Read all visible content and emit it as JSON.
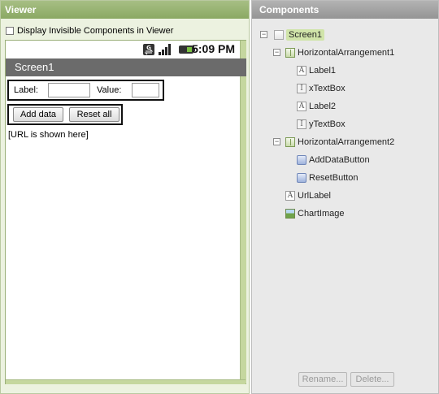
{
  "viewer": {
    "title": "Viewer",
    "invisible_checkbox_label": "Display Invisible Components in Viewer",
    "status_bar": {
      "time": "5:09 PM"
    },
    "screen_title": "Screen1",
    "harr1": {
      "label_text": "Label:",
      "value_text": "Value:"
    },
    "harr2": {
      "add_button": "Add data",
      "reset_button": "Reset all"
    },
    "url_label": "[URL is shown here]"
  },
  "components": {
    "title": "Components",
    "tree": {
      "screen1": "Screen1",
      "harr1": "HorizontalArrangement1",
      "label1": "Label1",
      "xtextbox": "xTextBox",
      "label2": "Label2",
      "ytextbox": "yTextBox",
      "harr2": "HorizontalArrangement2",
      "adddatabutton": "AddDataButton",
      "resetbutton": "ResetButton",
      "urllabel": "UrlLabel",
      "chartimage": "ChartImage"
    },
    "rename_button": "Rename...",
    "delete_button": "Delete..."
  },
  "colors": {
    "viewer_header": "#8aa863",
    "components_header": "#949494",
    "selection": "#d0e4a9"
  }
}
